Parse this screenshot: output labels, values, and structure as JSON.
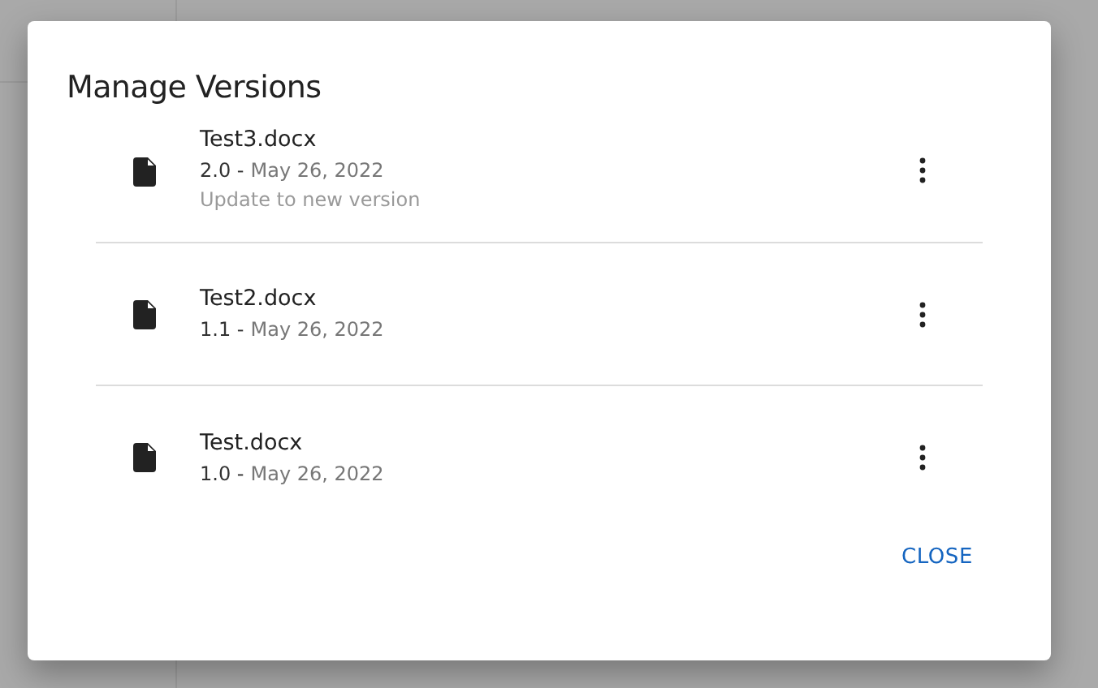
{
  "dialog": {
    "title": "Manage Versions",
    "versions": [
      {
        "file_name": "Test3.docx",
        "version": "2.0 -",
        "date": "May 26, 2022",
        "note": "Update to new version"
      },
      {
        "file_name": "Test2.docx",
        "version": "1.1 -",
        "date": "May 26, 2022"
      },
      {
        "file_name": "Test.docx",
        "version": "1.0 -",
        "date": "May 26, 2022"
      }
    ],
    "buttons": [
      "CLOSE"
    ]
  }
}
